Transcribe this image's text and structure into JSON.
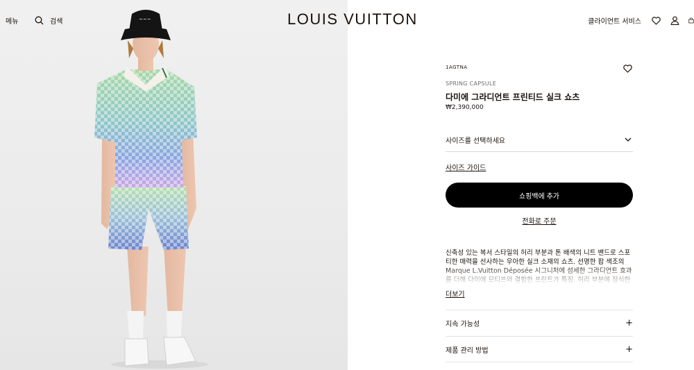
{
  "header": {
    "menu_label": "메뉴",
    "search_label": "검색",
    "logo": "LOUIS VUITTON",
    "client_service": "클라이언트 서비스",
    "icons": [
      "search-icon",
      "heart-icon",
      "user-icon",
      "shopping-bag-icon"
    ]
  },
  "product": {
    "sku": "1AGTNA",
    "capsule": "SPRING CAPSULE",
    "name": "다미에 그라디언트 프린티드 실크 쇼츠",
    "price": "₩2,390,000",
    "size_placeholder": "사이즈를 선택하세요",
    "size_guide": "사이즈 가이드",
    "add_to_bag": "쇼핑백에 추가",
    "phone_order": "전화로 주문",
    "description": "신축성 있는 복서 스타일의 허리 부분과 톤 배색의 니트 밴드로 스포티한 매력을 선사하는 우아한 실크 소재의 쇼츠. 선명한 팝 색조의 Marque L.Vuitton Déposée 시그니처에 섬세한 그라디언트 효과를 더해 다미에 모티프와 결합한 프린트가 특징. 허리 부분에 장식한",
    "read_more": "더보기",
    "accordions": [
      {
        "label": "지속 가능성",
        "icon": "plus-icon"
      },
      {
        "label": "제품 관리 방법",
        "icon": "plus-icon"
      }
    ]
  },
  "colors": {
    "text": "#19110b",
    "button_bg": "#000000",
    "image_bg": "#ededed"
  }
}
